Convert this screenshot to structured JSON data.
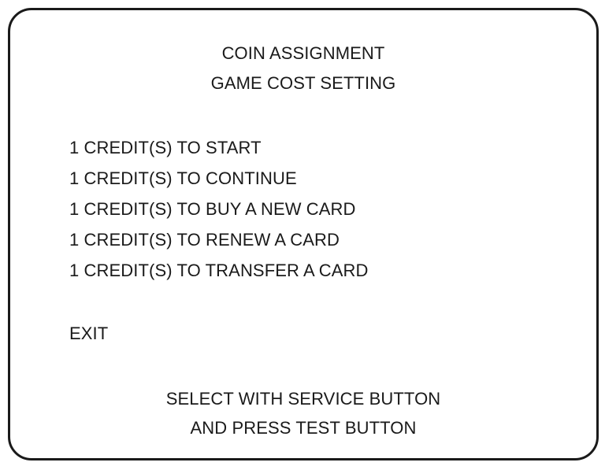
{
  "header": {
    "title": "COIN ASSIGNMENT",
    "subtitle": "GAME COST SETTING"
  },
  "menu": {
    "items": [
      {
        "label": "1 CREDIT(S) TO START"
      },
      {
        "label": "1 CREDIT(S) TO CONTINUE"
      },
      {
        "label": "1 CREDIT(S) TO BUY A NEW CARD"
      },
      {
        "label": "1 CREDIT(S) TO RENEW A CARD"
      },
      {
        "label": "1 CREDIT(S) TO TRANSFER A CARD"
      }
    ],
    "exit_label": "EXIT"
  },
  "footer": {
    "line1": "SELECT WITH SERVICE BUTTON",
    "line2": "AND PRESS TEST BUTTON"
  }
}
